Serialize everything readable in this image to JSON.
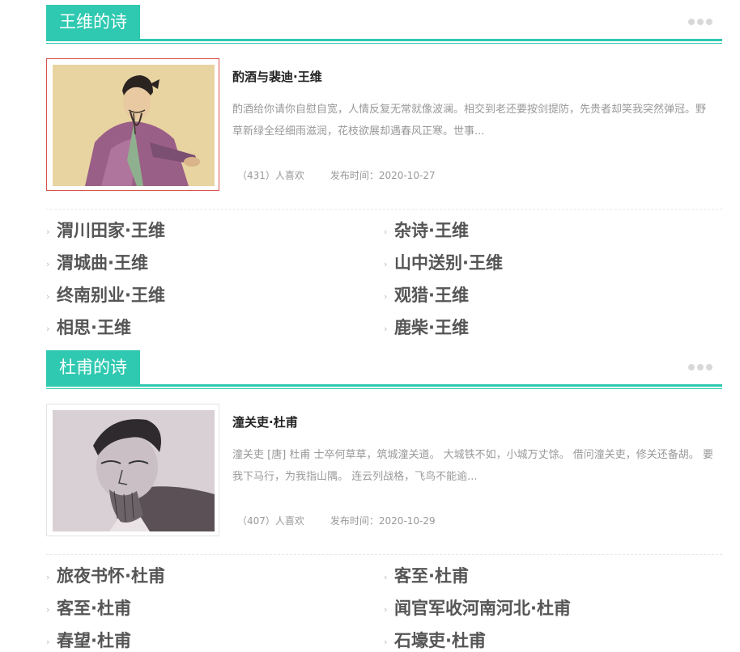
{
  "colors": {
    "accent": "#2ec9b0",
    "selected_border": "#d9534f"
  },
  "sections": [
    {
      "title": "王维的诗",
      "more_icon": "ellipsis-icon",
      "featured": {
        "title": "酌酒与裴迪·王维",
        "desc": "酌酒给你请你自慰自宽，人情反复无常就像波澜。相交到老还要按剑提防，先贵者却笑我突然弹冠。野草新绿全经细雨滋润，花枝欲展却遇春风正寒。世事...",
        "likes": "（431）人喜欢",
        "date": "发布时间：2020-10-27"
      },
      "poems": [
        "渭川田家·王维",
        "杂诗·王维",
        "渭城曲·王维",
        "山中送别·王维",
        "终南别业·王维",
        "观猎·王维",
        "相思·王维",
        "鹿柴·王维"
      ]
    },
    {
      "title": "杜甫的诗",
      "more_icon": "ellipsis-icon",
      "featured": {
        "title": "潼关吏·杜甫",
        "desc": "潼关吏 [唐] 杜甫 士卒何草草，筑城潼关道。 大城铁不如，小城万丈馀。 借问潼关吏，修关还备胡。 要我下马行，为我指山隅。 连云列战格，飞鸟不能逾...",
        "likes": "（407）人喜欢",
        "date": "发布时间：2020-10-29"
      },
      "poems": [
        "旅夜书怀·杜甫",
        "客至·杜甫",
        "客至·杜甫",
        "闻官军收河南河北·杜甫",
        "春望·杜甫",
        "石壕吏·杜甫"
      ]
    }
  ]
}
